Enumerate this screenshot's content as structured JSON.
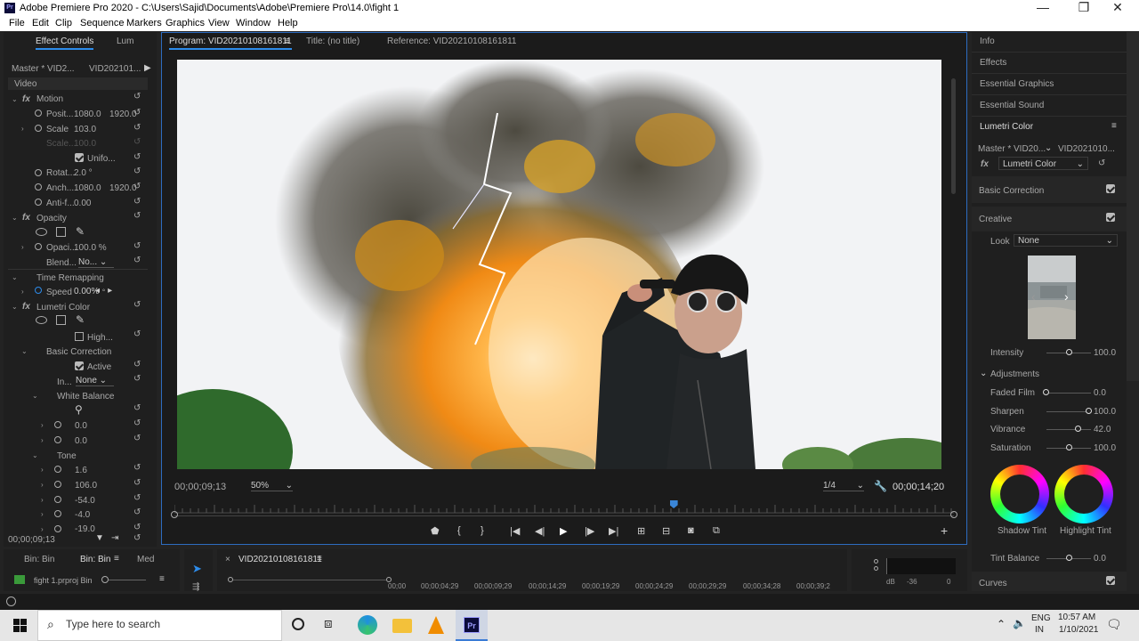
{
  "window": {
    "title": "Adobe Premiere Pro 2020 - C:\\Users\\Sajid\\Documents\\Adobe\\Premiere Pro\\14.0\\fight 1",
    "app_badge": "Pr"
  },
  "menu": [
    "File",
    "Edit",
    "Clip",
    "Sequence",
    "Markers",
    "Graphics",
    "View",
    "Window",
    "Help"
  ],
  "effect_controls": {
    "tabs": [
      "Effect Controls",
      "Lum"
    ],
    "master": "Master * VID2...",
    "clip": "VID202101...",
    "video_label": "Video",
    "motion": "Motion",
    "position_label": "Posit...",
    "position_x": "1080.0",
    "position_y": "1920.0",
    "scale_label": "Scale",
    "scale_value": "103.0",
    "scale_w_label": "Scale...",
    "scale_w_value": "100.0",
    "uniform_label": "Unifo...",
    "rotation_label": "Rotat...",
    "rotation_value": "2.0 °",
    "anchor_label": "Anch...",
    "anchor_x": "1080.0",
    "anchor_y": "1920.0",
    "antiflicker_label": "Anti-f...",
    "antiflicker_value": "0.00",
    "opacity": "Opacity",
    "opacity_label": "Opaci...",
    "opacity_value": "100.0 %",
    "blend_label": "Blend...",
    "blend_value": "No...",
    "time_remap": "Time Remapping",
    "speed_label": "Speed",
    "speed_value": "0.00%",
    "lumetri": "Lumetri Color",
    "high_label": "High...",
    "basic_correction": "Basic Correction",
    "active_label": "Active",
    "input_label": "In...",
    "input_value": "None",
    "white_balance": "White Balance",
    "wb_values": [
      "0.0",
      "0.0"
    ],
    "tone": "Tone",
    "tone_values": [
      "1.6",
      "106.0",
      "-54.0",
      "-4.0",
      "-19.0"
    ],
    "timecode": "00;00;09;13"
  },
  "program": {
    "tabs": [
      "Program: VID20210108161811",
      "Title: (no title)",
      "Reference: VID20210108161811"
    ],
    "timecode": "00;00;09;13",
    "zoom": "50%",
    "resolution": "1/4",
    "duration": "00;00;14;20",
    "playhead_fraction": 0.64
  },
  "right_panels": [
    "Info",
    "Effects",
    "Essential Graphics",
    "Essential Sound"
  ],
  "lumetri_panel": {
    "title": "Lumetri Color",
    "master": "Master * VID20...",
    "clip": "VID2021010...",
    "effect": "Lumetri Color",
    "basic_correction": "Basic Correction",
    "creative": "Creative",
    "look_label": "Look",
    "look_value": "None",
    "intensity_label": "Intensity",
    "intensity_value": "100.0",
    "adjustments": "Adjustments",
    "faded_film_label": "Faded Film",
    "faded_film_value": "0.0",
    "sharpen_label": "Sharpen",
    "sharpen_value": "100.0",
    "vibrance_label": "Vibrance",
    "vibrance_value": "42.0",
    "saturation_label": "Saturation",
    "saturation_value": "100.0",
    "shadow_tint": "Shadow Tint",
    "highlight_tint": "Highlight Tint",
    "tint_balance_label": "Tint Balance",
    "tint_balance_value": "0.0",
    "curves": "Curves"
  },
  "bottom": {
    "bin_tabs": [
      "Bin: Bin",
      "Bin: Bin",
      "Med"
    ],
    "bin_item": "fight 1.prproj Bin",
    "sequence_tab": "VID20210108161811",
    "ruler": [
      "00;00",
      "00;00;04;29",
      "00;00;09;29",
      "00;00;14;29",
      "00;00;19;29",
      "00;00;24;29",
      "00;00;29;29",
      "00;00;34;28",
      "00;00;39;2"
    ],
    "meter_labels": [
      "dB",
      "-36",
      "0"
    ]
  },
  "taskbar": {
    "search_placeholder": "Type here to search",
    "lang1": "ENG",
    "lang2": "IN",
    "time": "10:57 AM",
    "date": "1/10/2021"
  }
}
